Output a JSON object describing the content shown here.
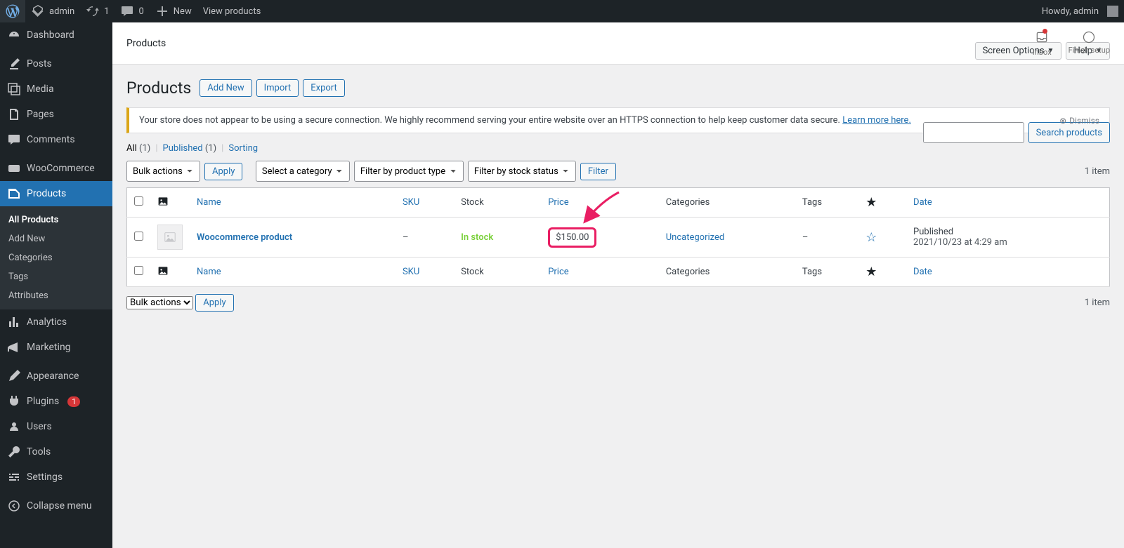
{
  "toolbar": {
    "site_name": "admin",
    "updates_count": "1",
    "comments_count": "0",
    "new_label": "New",
    "view_products": "View products",
    "howdy": "Howdy, admin"
  },
  "menu": {
    "dashboard": "Dashboard",
    "posts": "Posts",
    "media": "Media",
    "pages": "Pages",
    "comments": "Comments",
    "woocommerce": "WooCommerce",
    "products": "Products",
    "analytics": "Analytics",
    "marketing": "Marketing",
    "appearance": "Appearance",
    "plugins": "Plugins",
    "plugins_badge": "1",
    "users": "Users",
    "tools": "Tools",
    "settings": "Settings",
    "collapse": "Collapse menu",
    "submenu": {
      "all_products": "All Products",
      "add_new": "Add New",
      "categories": "Categories",
      "tags": "Tags",
      "attributes": "Attributes"
    }
  },
  "wc_header": {
    "title": "Products",
    "inbox": "Inbox",
    "finish_setup": "Finish setup"
  },
  "page": {
    "heading": "Products",
    "add_new": "Add New",
    "import": "Import",
    "export": "Export",
    "screen_options": "Screen Options",
    "help": "Help"
  },
  "notice": {
    "text": "Your store does not appear to be using a secure connection. We highly recommend serving your entire website over an HTTPS connection to help keep customer data secure. ",
    "link": "Learn more here.",
    "dismiss": "Dismiss"
  },
  "views": {
    "all_label": "All",
    "all_count": "(1)",
    "published_label": "Published",
    "published_count": "(1)",
    "sorting": "Sorting"
  },
  "search": {
    "button": "Search products"
  },
  "bulk": {
    "select": "Bulk actions",
    "apply": "Apply"
  },
  "filters": {
    "category": "Select a category",
    "type": "Filter by product type",
    "stock": "Filter by stock status",
    "button": "Filter"
  },
  "count": "1 item",
  "columns": {
    "name": "Name",
    "sku": "SKU",
    "stock": "Stock",
    "price": "Price",
    "categories": "Categories",
    "tags": "Tags",
    "date": "Date"
  },
  "rows": [
    {
      "name": "Woocommerce product",
      "sku": "–",
      "stock": "In stock",
      "price": "$150.00",
      "categories": "Uncategorized",
      "tags": "–",
      "date_status": "Published",
      "date_value": "2021/10/23 at 4:29 am"
    }
  ],
  "annotation": {
    "highlight_color": "#e91e63"
  }
}
